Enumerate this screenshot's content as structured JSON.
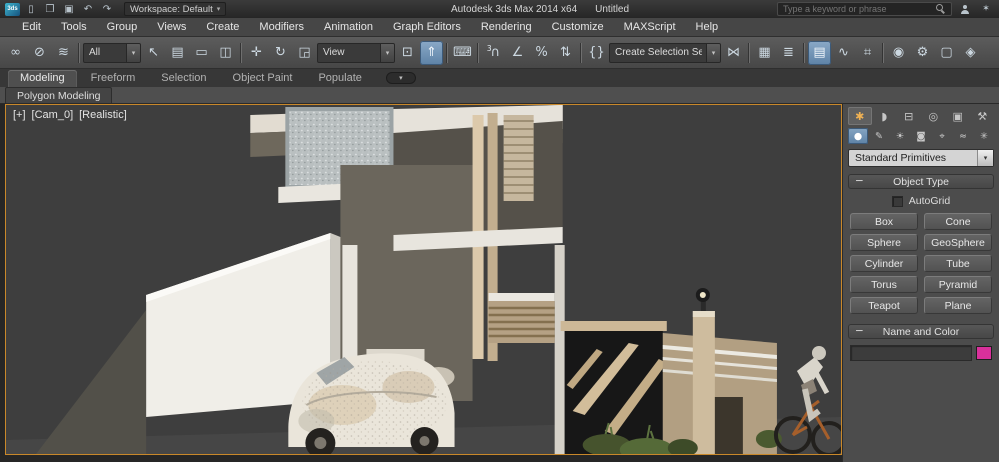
{
  "titlebar": {
    "app_title": "Autodesk 3ds Max 2014 x64",
    "doc_title": "Untitled",
    "workspace_label": "Workspace: Default",
    "search_placeholder": "Type a keyword or phrase"
  },
  "menubar": {
    "items": [
      "Edit",
      "Tools",
      "Group",
      "Views",
      "Create",
      "Modifiers",
      "Animation",
      "Graph Editors",
      "Rendering",
      "Customize",
      "MAXScript",
      "Help"
    ]
  },
  "toolbar": {
    "selection_filter_value": "All",
    "coordinate_system_value": "View",
    "selection_sets_value": "Create Selection Se",
    "snap_mode": "3"
  },
  "ribbon": {
    "tabs": [
      "Modeling",
      "Freeform",
      "Selection",
      "Object Paint",
      "Populate"
    ],
    "subtab": "Polygon Modeling"
  },
  "viewport": {
    "general_label": "[+]",
    "pov_label": "[Cam_0]",
    "shading_label": "[Realistic]"
  },
  "command_panel": {
    "primitive_category": "Standard Primitives",
    "object_type": {
      "title": "Object Type",
      "autogrid_label": "AutoGrid",
      "buttons": [
        "Box",
        "Cone",
        "Sphere",
        "GeoSphere",
        "Cylinder",
        "Tube",
        "Torus",
        "Pyramid",
        "Teapot",
        "Plane"
      ]
    },
    "name_and_color": {
      "title": "Name and Color",
      "name_value": ""
    }
  },
  "colors": {
    "viewport_border": "#c9882a",
    "active_button_blue": "#6f93b5",
    "name_color_swatch": "#d9309b"
  },
  "icons": {
    "logo": "3ds",
    "new_file": "▯",
    "open_file": "❒",
    "save_file": "▣",
    "undo": "↶",
    "redo": "↷",
    "dropdown_arrow": "▾",
    "star": "✶",
    "select_link": "∞",
    "unlink": "⊘",
    "bind_spacewarp": "≋",
    "select_object": "↖",
    "select_by_name": "▤",
    "rect_region": "▭",
    "window_crossing": "◫",
    "move": "✛",
    "rotate": "↻",
    "scale": "◲",
    "pivot_center": "⊡",
    "manipulate": "⇑",
    "keyboard_override": "⌨",
    "magnet": "∩",
    "angle_snap": "∠",
    "percent_snap": "%",
    "spinner_snap": "⇅",
    "named_sets": "{}",
    "mirror": "⋈",
    "align": "▦",
    "layers": "≣",
    "ribbon_toggle": "▤",
    "curve_editor": "∿",
    "schematic_view": "⌗",
    "material_editor": "◉",
    "render_setup": "⚙",
    "rendered_frame": "▢",
    "render": "◈",
    "tab_create": "✱",
    "tab_modify": "◗",
    "tab_hierarchy": "⊟",
    "tab_motion": "◎",
    "tab_display": "▣",
    "tab_utilities": "⚒",
    "cat_geometry": "●",
    "cat_shapes": "✎",
    "cat_lights": "☀",
    "cat_cameras": "◙",
    "cat_helpers": "⌖",
    "cat_spacewarps": "≈",
    "cat_systems": "✳",
    "rollout_collapse": "−"
  }
}
